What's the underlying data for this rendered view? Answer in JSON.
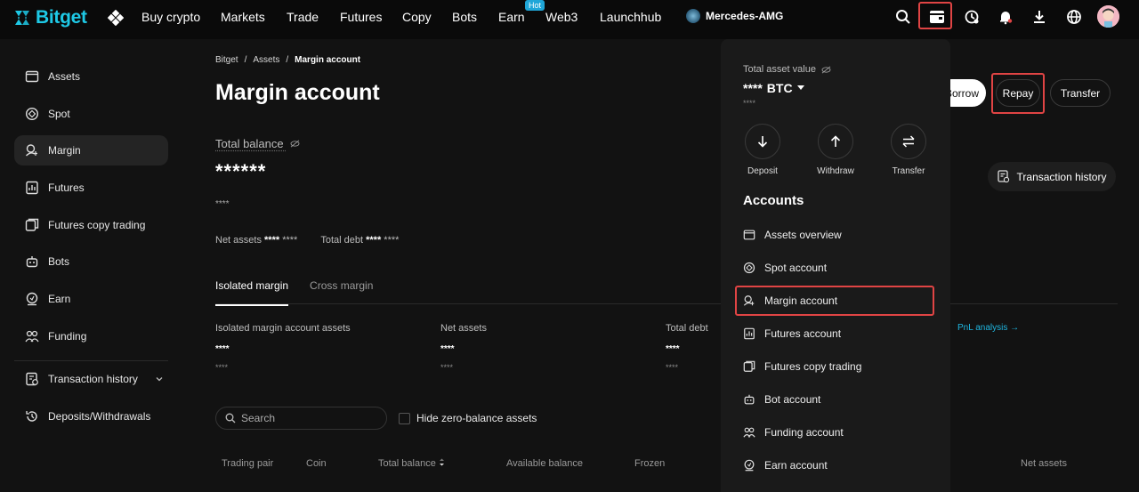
{
  "brand": {
    "name": "Bitget",
    "accent": "#1ec9e6"
  },
  "nav": {
    "items": [
      "Buy crypto",
      "Markets",
      "Trade",
      "Futures",
      "Copy",
      "Bots",
      "Earn",
      "Web3",
      "Launchhub"
    ],
    "hot_badge": "Hot",
    "partner": "Mercedes-AMG",
    "icons": [
      "search-icon",
      "wallet-icon",
      "clock-icon",
      "bell-icon",
      "download-icon",
      "globe-icon",
      "avatar"
    ]
  },
  "sidebar": {
    "items": [
      {
        "label": "Assets",
        "icon": "wallet-icon"
      },
      {
        "label": "Spot",
        "icon": "spot-icon"
      },
      {
        "label": "Margin",
        "icon": "margin-icon",
        "active": true
      },
      {
        "label": "Futures",
        "icon": "futures-icon"
      },
      {
        "label": "Futures copy trading",
        "icon": "copy-trading-icon"
      },
      {
        "label": "Bots",
        "icon": "bot-icon"
      },
      {
        "label": "Earn",
        "icon": "earn-icon"
      },
      {
        "label": "Funding",
        "icon": "funding-icon"
      },
      {
        "label": "Transaction history",
        "icon": "history-icon"
      },
      {
        "label": "Deposits/Withdrawals",
        "icon": "deposit-icon"
      }
    ]
  },
  "main": {
    "breadcrumb": [
      "Bitget",
      "Assets",
      "Margin account"
    ],
    "breadcrumb_sep": "/",
    "title": "Margin account",
    "total_balance_label": "Total balance",
    "total_balance_value": "******",
    "total_balance_sub": "****",
    "net_assets_label": "Net assets",
    "net_assets_value": "****",
    "net_assets_sub": "****",
    "total_debt_label": "Total debt",
    "total_debt_value": "****",
    "total_debt_sub": "****",
    "tabs": [
      "Isolated margin",
      "Cross margin"
    ],
    "stats": [
      {
        "label": "Isolated margin account assets",
        "value": "****",
        "sub": "****"
      },
      {
        "label": "Net assets",
        "value": "****",
        "sub": "****"
      },
      {
        "label": "Total debt",
        "value": "****",
        "sub": "****"
      }
    ],
    "pnl_link": "PnL analysis →",
    "search_placeholder": "Search",
    "hide_zero": "Hide zero-balance assets",
    "columns": [
      "Trading pair",
      "Coin",
      "Total balance",
      "Available balance",
      "Frozen",
      "Net assets"
    ],
    "buttons": {
      "borrow": "Borrow",
      "repay": "Repay",
      "transfer": "Transfer",
      "tx_history": "Transaction history"
    }
  },
  "dropdown": {
    "total_label": "Total asset value",
    "value": "****",
    "currency": "BTC",
    "sub": "****",
    "actions": [
      "Deposit",
      "Withdraw",
      "Transfer"
    ],
    "heading": "Accounts",
    "accounts": [
      "Assets overview",
      "Spot account",
      "Margin account",
      "Futures account",
      "Futures copy trading",
      "Bot account",
      "Funding account",
      "Earn account"
    ]
  }
}
